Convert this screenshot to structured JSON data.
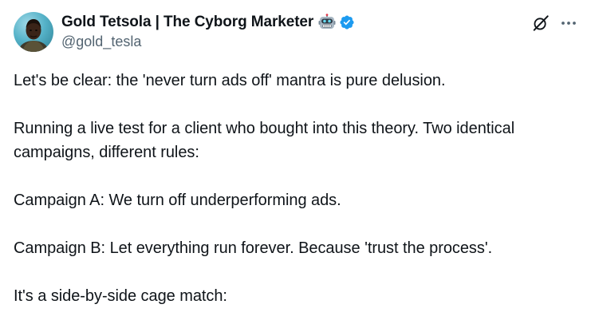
{
  "author": {
    "display_name": "Gold Tetsola | The Cyborg Marketer",
    "handle": "@gold_tesla",
    "emoji_icon": "robot-face-icon",
    "verified_icon": "verified-badge-icon",
    "verified_color": "#1d9bf0"
  },
  "header_actions": {
    "grok_icon": "grok-icon",
    "more_icon": "more-icon"
  },
  "tweet": {
    "paragraphs": [
      "Let's be clear: the 'never turn ads off' mantra is pure delusion.",
      "Running a live test for a client who bought into this theory. Two identical campaigns, different rules:",
      "Campaign A: We turn off underperforming ads.",
      "Campaign B: Let everything run forever. Because 'trust the process'.",
      "It's a side-by-side cage match:"
    ]
  },
  "colors": {
    "text_primary": "#0f1419",
    "text_secondary": "#536471",
    "accent": "#1d9bf0"
  }
}
